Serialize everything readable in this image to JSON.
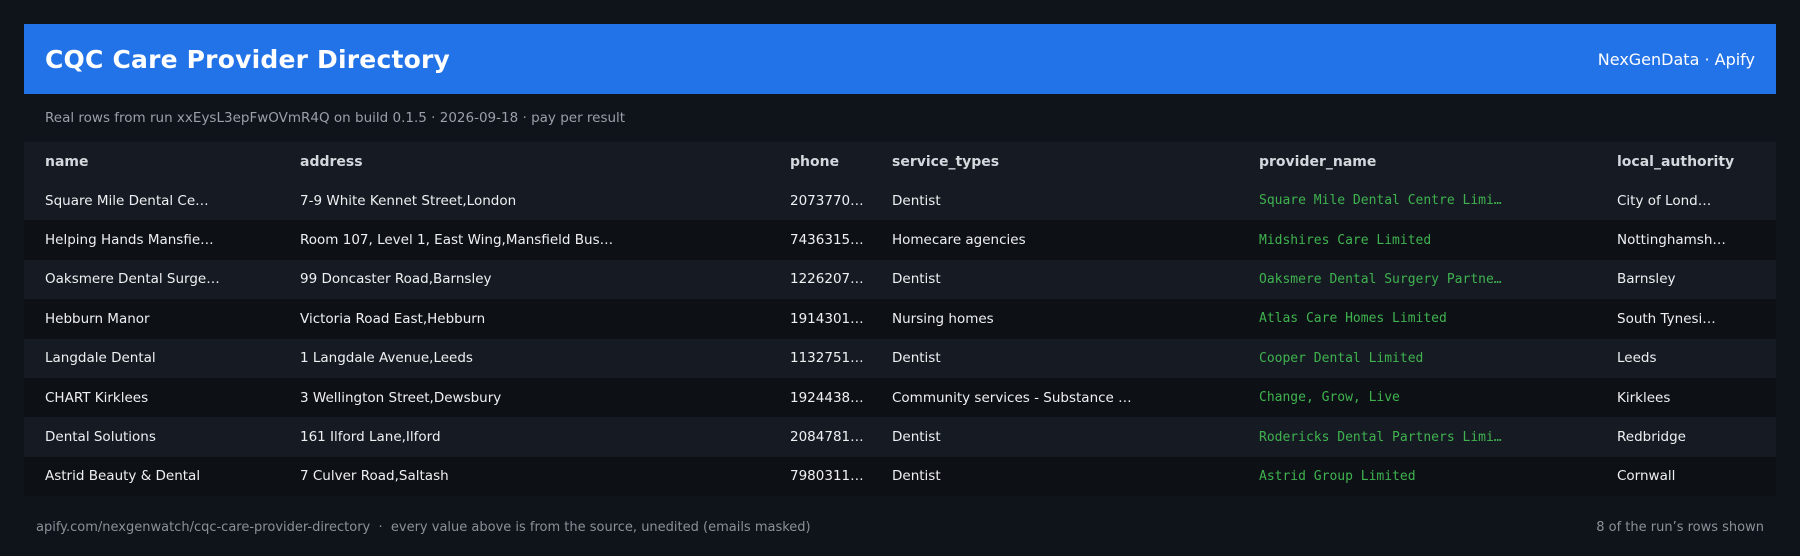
{
  "header": {
    "title": "CQC Care Provider Directory",
    "brand": "NexGenData · Apify"
  },
  "subtitle": "Real rows from run xxEysL3epFwOVmR4Q on build 0.1.5 · 2026-09-18 · pay per result",
  "table": {
    "columns": [
      "name",
      "address",
      "phone",
      "service_types",
      "provider_name",
      "local_authority"
    ],
    "rows": [
      {
        "name": "Square Mile Dental Ce…",
        "address": "7-9 White Kennet Street,London",
        "phone": "2073770…",
        "service_types": "Dentist",
        "provider_name": "Square Mile Dental Centre Limi…",
        "local_authority": "City of Lond…"
      },
      {
        "name": "Helping Hands Mansfie…",
        "address": "Room 107, Level 1, East Wing,Mansfield Bus…",
        "phone": "7436315…",
        "service_types": "Homecare agencies",
        "provider_name": "Midshires Care Limited",
        "local_authority": "Nottinghamsh…"
      },
      {
        "name": "Oaksmere Dental Surge…",
        "address": "99 Doncaster Road,Barnsley",
        "phone": "1226207…",
        "service_types": "Dentist",
        "provider_name": "Oaksmere Dental Surgery Partne…",
        "local_authority": "Barnsley"
      },
      {
        "name": "Hebburn Manor",
        "address": "Victoria Road East,Hebburn",
        "phone": "1914301…",
        "service_types": "Nursing homes",
        "provider_name": "Atlas Care Homes Limited",
        "local_authority": "South Tynesi…"
      },
      {
        "name": "Langdale Dental",
        "address": "1 Langdale Avenue,Leeds",
        "phone": "1132751…",
        "service_types": "Dentist",
        "provider_name": "Cooper Dental Limited",
        "local_authority": "Leeds"
      },
      {
        "name": "CHART Kirklees",
        "address": "3 Wellington Street,Dewsbury",
        "phone": "1924438…",
        "service_types": "Community services - Substance …",
        "provider_name": "Change, Grow, Live",
        "local_authority": "Kirklees"
      },
      {
        "name": "Dental Solutions",
        "address": "161 Ilford Lane,Ilford",
        "phone": "2084781…",
        "service_types": "Dentist",
        "provider_name": "Rodericks Dental Partners Limi…",
        "local_authority": "Redbridge"
      },
      {
        "name": "Astrid Beauty & Dental",
        "address": "7 Culver Road,Saltash",
        "phone": "7980311…",
        "service_types": "Dentist",
        "provider_name": "Astrid Group Limited",
        "local_authority": "Cornwall"
      }
    ]
  },
  "footer": {
    "left": "apify.com/nexgenwatch/cqc-care-provider-directory  ·  every value above is from the source, unedited (emails masked)",
    "right": "8 of the run’s rows shown"
  },
  "colors": {
    "header_bg": "#2272e8",
    "page_bg": "#0f131a",
    "provider_text": "#3fb24f"
  }
}
